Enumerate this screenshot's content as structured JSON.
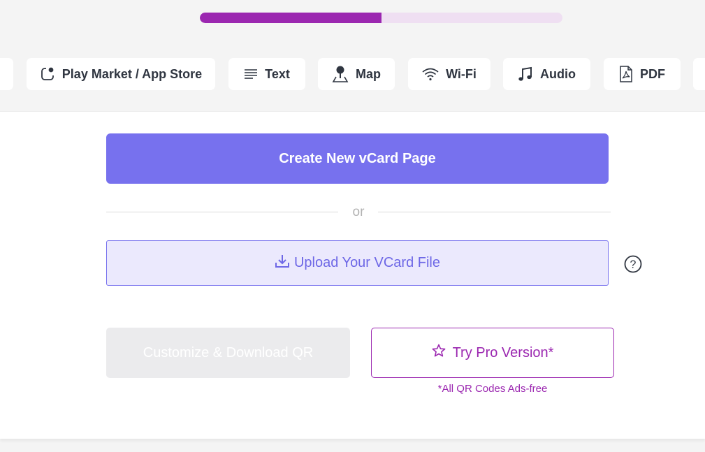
{
  "progress": {
    "value": 0.5
  },
  "tabs": [
    {
      "label": "",
      "icon": "partial-tab"
    },
    {
      "label": "Play Market / App Store",
      "icon": "app-store-icon"
    },
    {
      "label": "Text",
      "icon": "text-lines-icon"
    },
    {
      "label": "Map",
      "icon": "map-pin-icon"
    },
    {
      "label": "Wi-Fi",
      "icon": "wifi-icon"
    },
    {
      "label": "Audio",
      "icon": "music-note-icon"
    },
    {
      "label": "PDF",
      "icon": "pdf-icon"
    },
    {
      "label": "",
      "icon": "partial-tab"
    }
  ],
  "main": {
    "create_label": "Create New vCard Page",
    "or_label": "or",
    "upload_label": "Upload Your VCard File",
    "help_label": "?",
    "customize_label": "Customize & Download QR",
    "pro_label": "Try Pro Version*",
    "pro_note": "*All QR Codes Ads-free"
  },
  "colors": {
    "accent": "#7771ee",
    "pro": "#9b27b0",
    "progress_track": "#efdff2",
    "disabled": "#ebebed"
  }
}
